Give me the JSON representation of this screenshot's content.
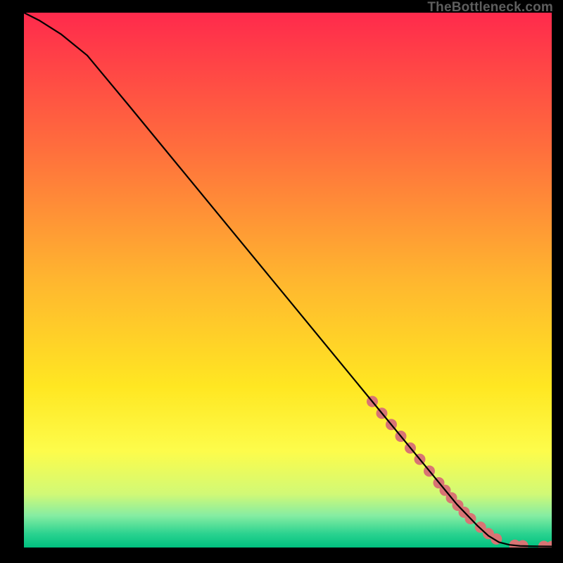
{
  "watermark": "TheBottleneck.com",
  "chart_data": {
    "type": "line",
    "title": "",
    "xlabel": "",
    "ylabel": "",
    "xlim": [
      0,
      100
    ],
    "ylim": [
      0,
      100
    ],
    "background_gradient": {
      "stops": [
        {
          "pos": 0.0,
          "color": "#ff2a4c"
        },
        {
          "pos": 0.25,
          "color": "#ff6d3d"
        },
        {
          "pos": 0.5,
          "color": "#ffb62f"
        },
        {
          "pos": 0.7,
          "color": "#ffe722"
        },
        {
          "pos": 0.82,
          "color": "#fdfc4b"
        },
        {
          "pos": 0.9,
          "color": "#d1f976"
        },
        {
          "pos": 0.94,
          "color": "#86eda2"
        },
        {
          "pos": 0.975,
          "color": "#29d28f"
        },
        {
          "pos": 1.0,
          "color": "#00c07f"
        }
      ]
    },
    "series": [
      {
        "name": "curve",
        "type": "line",
        "x": [
          0,
          3,
          7,
          12,
          20,
          30,
          40,
          50,
          60,
          68,
          76,
          82,
          86,
          88,
          90,
          92,
          94,
          96,
          98,
          100
        ],
        "y": [
          100,
          98.5,
          96,
          92,
          82.5,
          70.5,
          58.5,
          46.5,
          34.5,
          24.9,
          15.3,
          8.1,
          4.0,
          2.2,
          1.0,
          0.5,
          0.3,
          0.25,
          0.22,
          0.2
        ]
      },
      {
        "name": "highlight-dots",
        "type": "scatter",
        "x": [
          66,
          67.8,
          69.6,
          71.4,
          73.2,
          75,
          76.8,
          78.6,
          79.8,
          81.0,
          82.2,
          83.4,
          84.6,
          86.5,
          88.0,
          89.5,
          93.0,
          94.5,
          98.5,
          100
        ],
        "y": [
          27.3,
          25.1,
          23.0,
          20.8,
          18.6,
          16.5,
          14.3,
          12.1,
          10.7,
          9.3,
          7.9,
          6.6,
          5.4,
          3.8,
          2.6,
          1.6,
          0.42,
          0.33,
          0.22,
          0.2
        ]
      }
    ]
  }
}
